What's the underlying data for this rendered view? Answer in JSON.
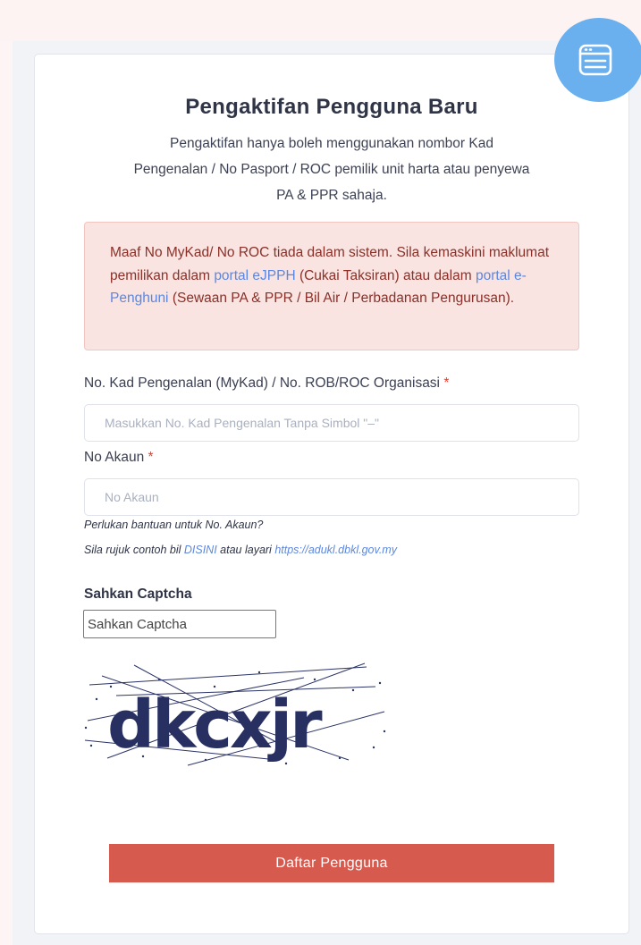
{
  "header": {
    "title": "Pengaktifan Pengguna Baru",
    "subtitle_line1": "Pengaktifan hanya boleh menggunakan nombor Kad",
    "subtitle_line2": "Pengenalan / No Pasport / ROC pemilik unit harta atau penyewa",
    "subtitle_line3": "PA & PPR sahaja."
  },
  "fab": {
    "icon": "window-list-icon",
    "color": "#6ab0ef"
  },
  "alert": {
    "text_part1": "Maaf No MyKad/ No ROC tiada dalam sistem. Sila kemaskini maklumat pemilikan dalam ",
    "link1": "portal eJPPH",
    "text_part2": " (Cukai Taksiran) atau dalam ",
    "link2": "portal e-Penghuni",
    "text_part3": " (Sewaan PA & PPR / Bil Air / Perbadanan Pengurusan)."
  },
  "form": {
    "mykad_label": "No. Kad Pengenalan (MyKad) / No. ROB/ROC Organisasi",
    "mykad_placeholder": "Masukkan No. Kad Pengenalan Tanpa Simbol \"–\"",
    "mykad_value": "",
    "akaun_label": "No Akaun",
    "akaun_placeholder": "No Akaun",
    "akaun_value": "",
    "required_mark": "*",
    "help_line1": "Perlukan bantuan untuk No. Akaun?",
    "help_prefix": "Sila rujuk contoh bil ",
    "help_link1": "DISINI",
    "help_middle": " atau layari ",
    "help_link2": "https://adukl.dbkl.gov.my"
  },
  "captcha": {
    "label": "Sahkan Captcha",
    "placeholder": "Sahkan Captcha",
    "value": "",
    "image_text": "dkcxjr"
  },
  "submit": {
    "label": "Daftar Pengguna",
    "color": "#d65a4e"
  }
}
